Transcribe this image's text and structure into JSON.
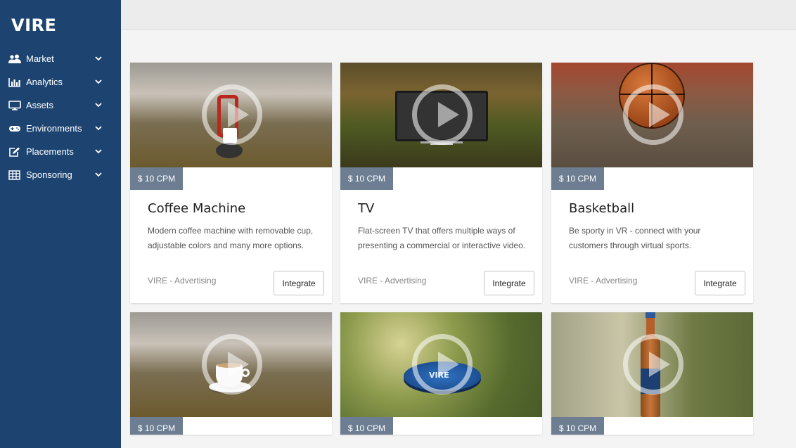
{
  "app": {
    "logo": "VIRE"
  },
  "sidebar": {
    "items": [
      {
        "label": "Market",
        "icon": "users-icon"
      },
      {
        "label": "Analytics",
        "icon": "bar-chart-icon"
      },
      {
        "label": "Assets",
        "icon": "monitor-icon"
      },
      {
        "label": "Environments",
        "icon": "gamepad-icon"
      },
      {
        "label": "Placements",
        "icon": "edit-icon"
      },
      {
        "label": "Sponsoring",
        "icon": "table-icon"
      }
    ]
  },
  "cards": [
    {
      "price": "$ 10 CPM",
      "title": "Coffee Machine",
      "description": "Modern coffee machine with removable cup, adjustable colors and many more options.",
      "meta": "VIRE - Advertising",
      "button": "Integrate"
    },
    {
      "price": "$ 10 CPM",
      "title": "TV",
      "description": "Flat-screen TV that offers multiple ways of presenting a commercial or interactive video.",
      "meta": "VIRE - Advertising",
      "button": "Integrate"
    },
    {
      "price": "$ 10 CPM",
      "title": "Basketball",
      "description": "Be sporty in VR - connect with your customers through virtual sports.",
      "meta": "VIRE - Advertising",
      "button": "Integrate"
    },
    {
      "price": "$ 10 CPM"
    },
    {
      "price": "$ 10 CPM",
      "coaster_text": "VIRE"
    },
    {
      "price": "$ 10 CPM"
    }
  ],
  "colors": {
    "sidebar": "#1d4471",
    "price_badge": "#6d7e92",
    "page_bg": "#f4f4f4"
  }
}
